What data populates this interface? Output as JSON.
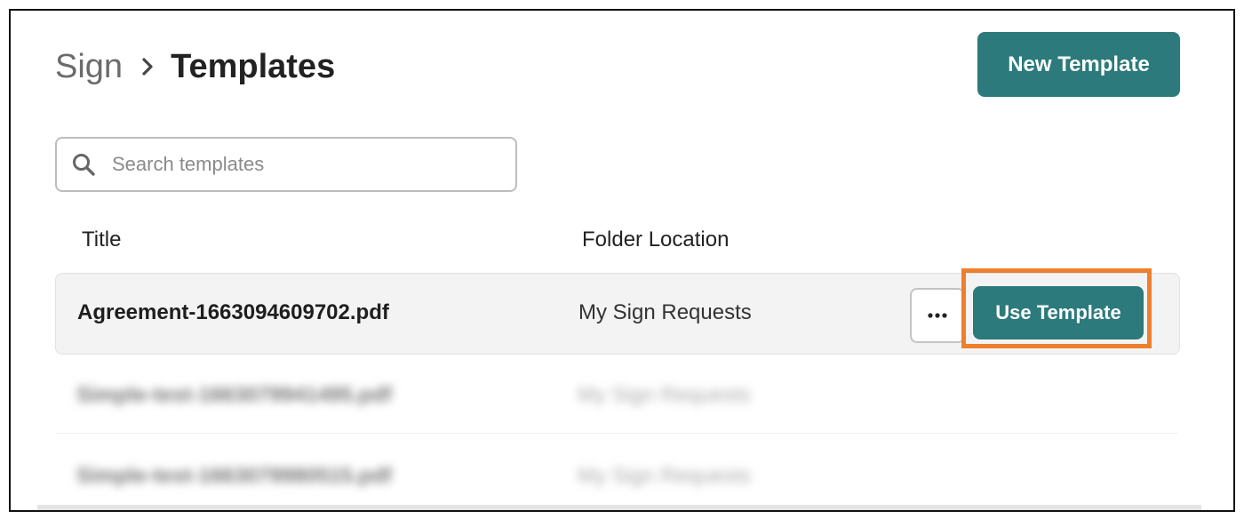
{
  "breadcrumb": {
    "root": "Sign",
    "current": "Templates",
    "separator_icon": "chevron-right-icon"
  },
  "header": {
    "new_template_label": "New Template"
  },
  "search": {
    "placeholder": "Search templates",
    "value": "",
    "icon": "search-icon"
  },
  "table": {
    "columns": [
      "Title",
      "Folder Location"
    ],
    "rows": [
      {
        "title": "Agreement-1663094609702.pdf",
        "folder": "My Sign Requests",
        "more_icon": "ellipsis-icon",
        "action_label": "Use Template"
      },
      {
        "title": "Simple-test-1663079941495.pdf",
        "folder": "My Sign Requests"
      },
      {
        "title": "Simple-test-1663079980515.pdf",
        "folder": "My Sign Requests"
      }
    ]
  },
  "colors": {
    "primary": "#2c7a7b",
    "highlight": "#ee7f2d",
    "row_background": "#f3f3f3"
  }
}
